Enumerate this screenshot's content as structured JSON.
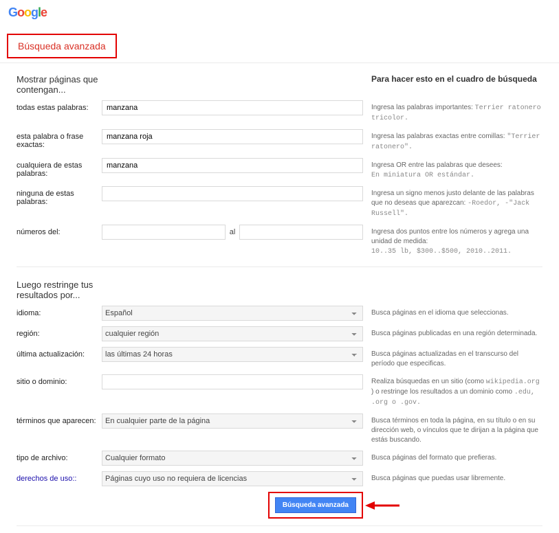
{
  "page_title": "Búsqueda avanzada",
  "section1_title": "Mostrar páginas que contengan...",
  "section1_hint_title": "Para hacer esto en el cuadro de búsqueda",
  "rows1": {
    "all_words": {
      "label": "todas estas palabras:",
      "value": "manzana",
      "hint_pre": "Ingresa las palabras importantes: ",
      "hint_code": "Terrier ratonero tricolor."
    },
    "exact": {
      "label": "esta palabra o frase exactas:",
      "value": "manzana roja",
      "hint_pre": "Ingresa las palabras exactas entre comillas: ",
      "hint_code": "\"Terrier ratonero\"."
    },
    "any": {
      "label": "cualquiera de estas palabras:",
      "value": "manzana",
      "hint_pre": "Ingresa OR entre las palabras que desees:",
      "hint_code": "En miniatura OR estándar."
    },
    "none": {
      "label": "ninguna de estas palabras:",
      "value": "",
      "hint_pre": "Ingresa un signo menos justo delante de las palabras que no deseas que aparezcan: ",
      "hint_code": "-Roedor, -\"Jack Russell\"."
    },
    "range": {
      "label": "números del:",
      "sep": "al",
      "hint_pre": "Ingresa dos puntos entre los números y agrega una unidad de medida:",
      "hint_code": "10..35 lb, $300..$500, 2010..2011."
    }
  },
  "section2_title": "Luego restringe tus resultados por...",
  "rows2": {
    "lang": {
      "label": "idioma:",
      "value": "Español",
      "hint": "Busca páginas en el idioma que seleccionas."
    },
    "region": {
      "label": "región:",
      "value": "cualquier región",
      "hint": "Busca páginas publicadas en una región determinada."
    },
    "update": {
      "label": "última actualización:",
      "value": "las últimas 24 horas",
      "hint": "Busca páginas actualizadas en el transcurso del período que especificas."
    },
    "site": {
      "label": "sitio o dominio:",
      "value": "",
      "hint_pre": "Realiza búsquedas en un sitio (como ",
      "hint_code1": "wikipedia.org",
      "hint_mid": " ) o restringe los resultados a un dominio como ",
      "hint_code2": ".edu, .org o .gov."
    },
    "terms": {
      "label": "términos que aparecen:",
      "value": "En cualquier parte de la página",
      "hint": "Busca términos en toda la página, en su título o en su dirección web, o vínculos que te dirijan a la página que estás buscando."
    },
    "filetype": {
      "label": "tipo de archivo:",
      "value": "Cualquier formato",
      "hint": "Busca páginas del formato que prefieras."
    },
    "rights": {
      "label": "derechos de uso::",
      "value": "Páginas cuyo uso no requiera de licencias",
      "hint": "Busca páginas que puedas usar libremente."
    }
  },
  "button_label": "Búsqueda avanzada"
}
